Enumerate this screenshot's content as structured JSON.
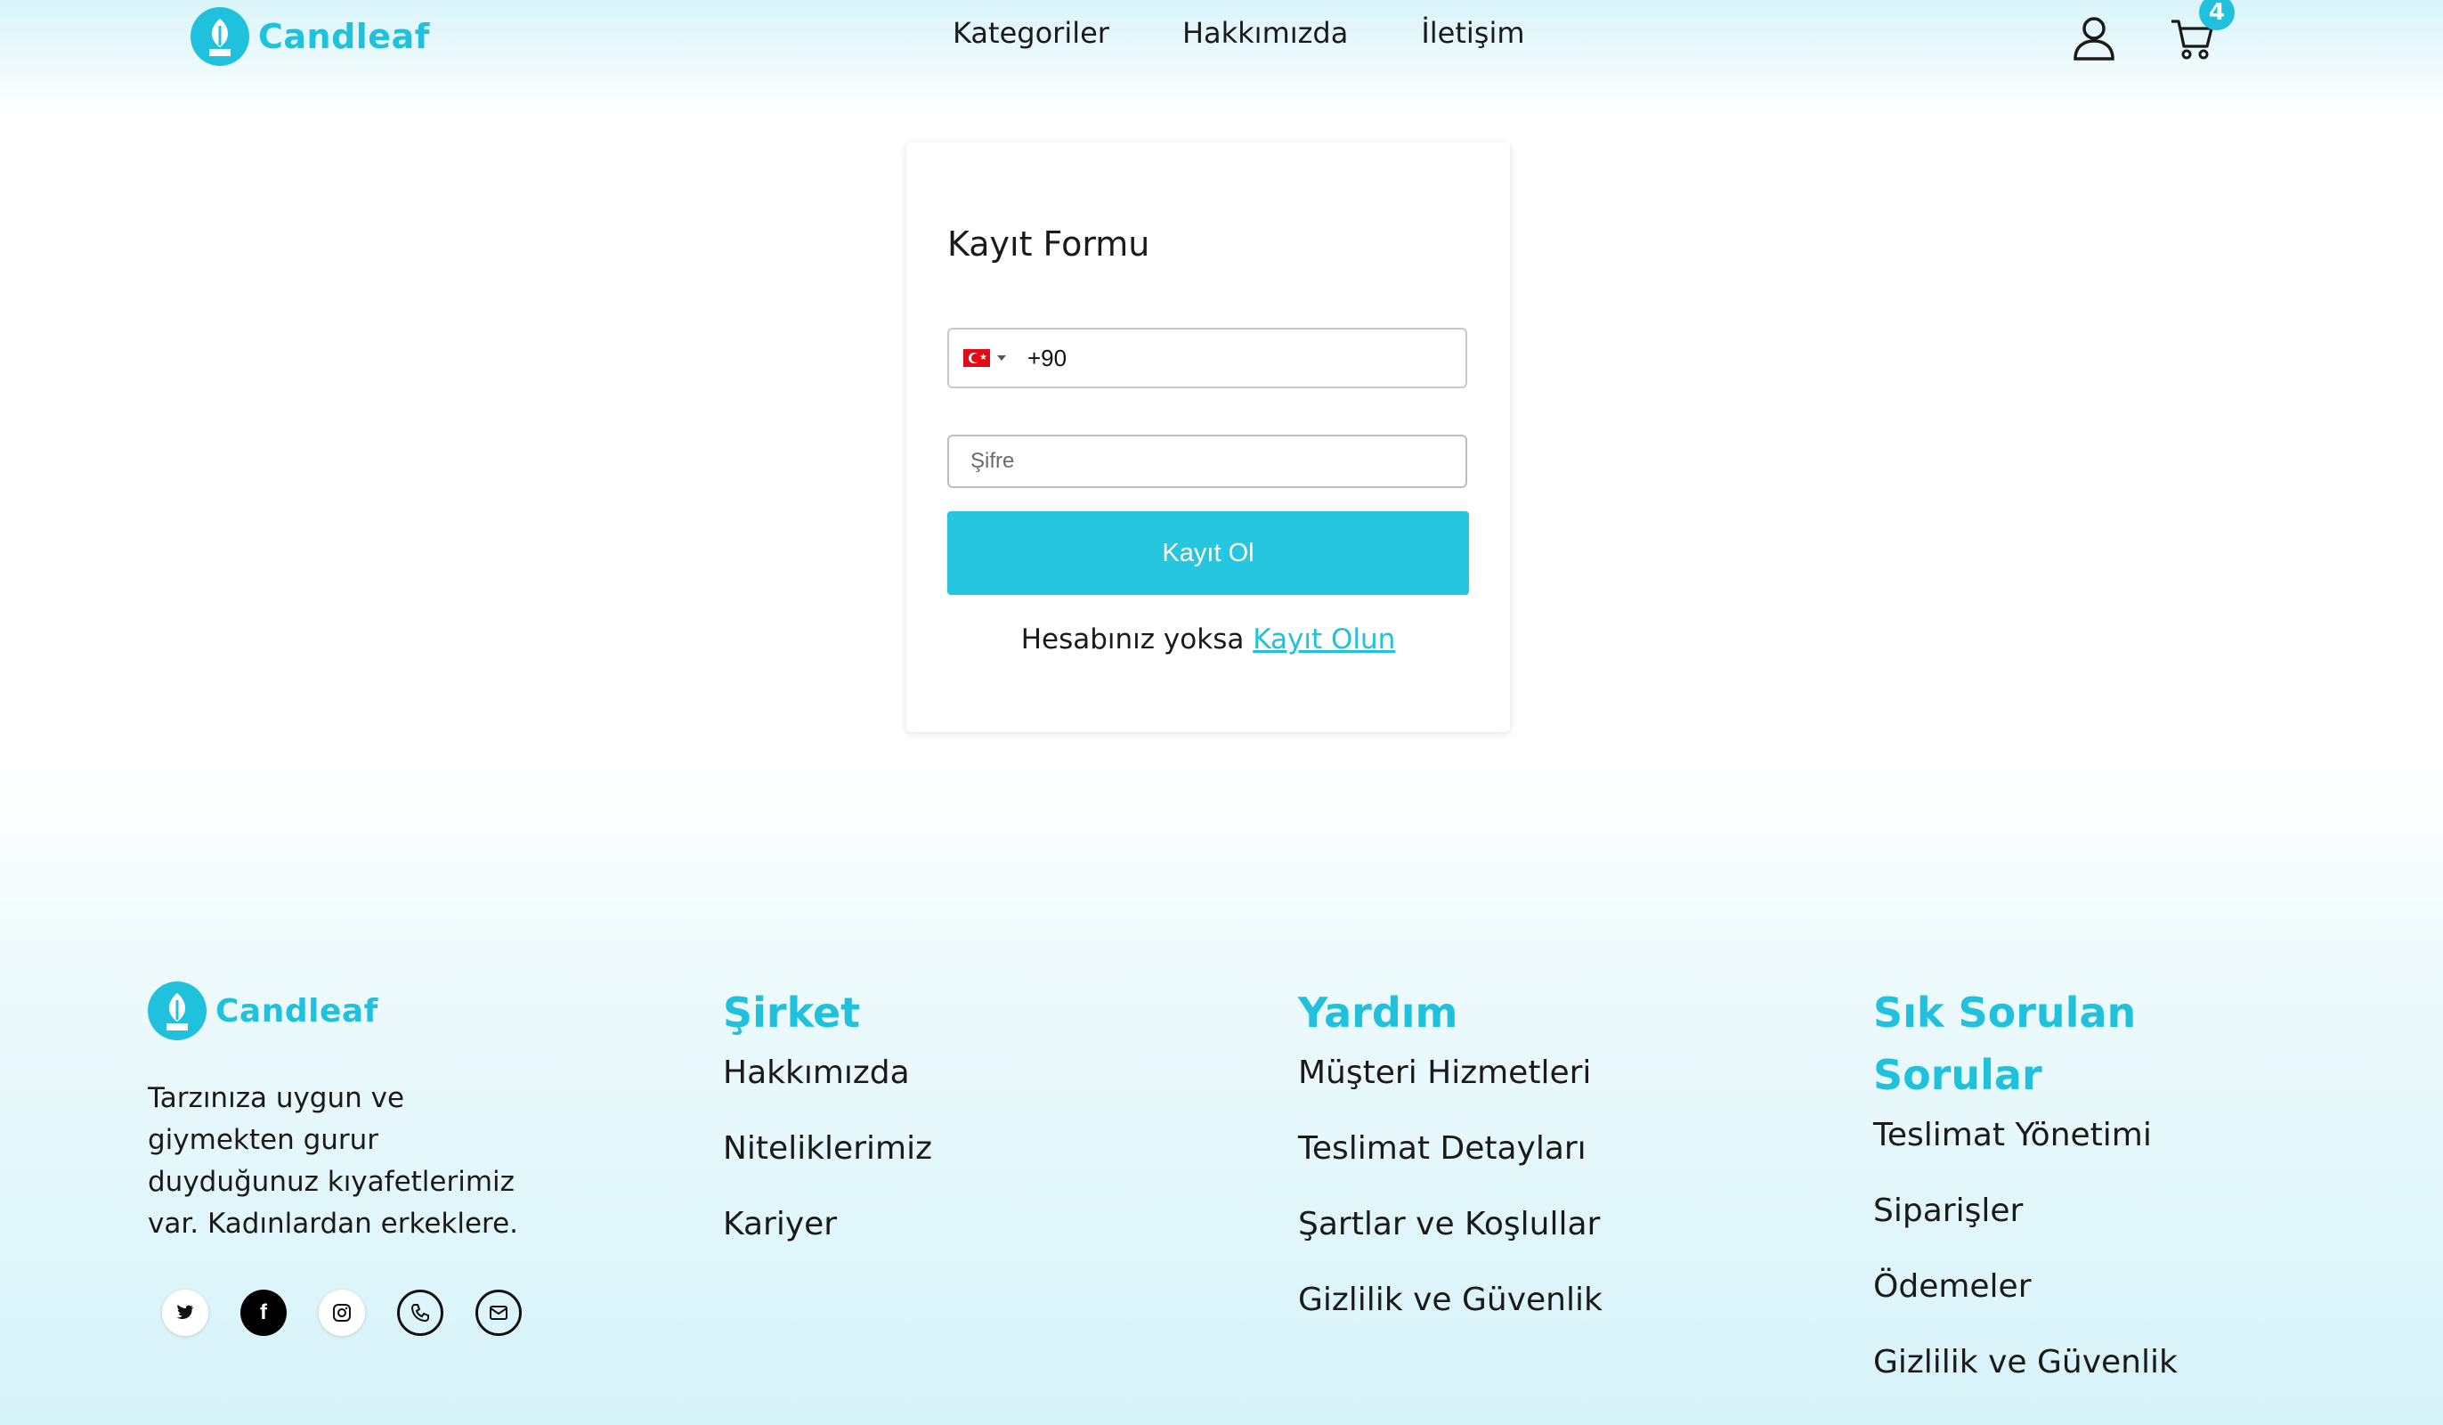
{
  "header": {
    "brand": "Candleaf",
    "nav": [
      "Kategoriler",
      "Hakkımızda",
      "İletişim"
    ],
    "cart_count": "4"
  },
  "form": {
    "title": "Kayıt Formu",
    "country_code": "+90",
    "password_placeholder": "Şifre",
    "submit_label": "Kayıt Ol",
    "signup_prompt": "Hesabınız yoksa",
    "signup_link": "Kayıt Olun"
  },
  "footer": {
    "brand": "Candleaf",
    "about": "Tarzınıza uygun ve giymekten gurur duyduğunuz kıyafetlerimiz var. Kadınlardan erkeklere.",
    "socials": [
      "twitter-icon",
      "facebook-icon",
      "instagram-icon",
      "phone-icon",
      "mail-icon"
    ],
    "columns": [
      {
        "title": "Şirket",
        "links": [
          "Hakkımızda",
          "Niteliklerimiz",
          "Kariyer"
        ]
      },
      {
        "title": "Yardım",
        "links": [
          "Müşteri Hizmetleri",
          "Teslimat Detayları",
          "Şartlar ve Koşlullar",
          "Gizlilik ve Güvenlik"
        ]
      },
      {
        "title": "Sık Sorulan Sorular",
        "links": [
          "Teslimat Yönetimi",
          "Siparişler",
          "Ödemeler",
          "Gizlilik ve Güvenlik"
        ]
      }
    ]
  },
  "colors": {
    "accent": "#1fc1dc",
    "button": "#26c6e0"
  }
}
